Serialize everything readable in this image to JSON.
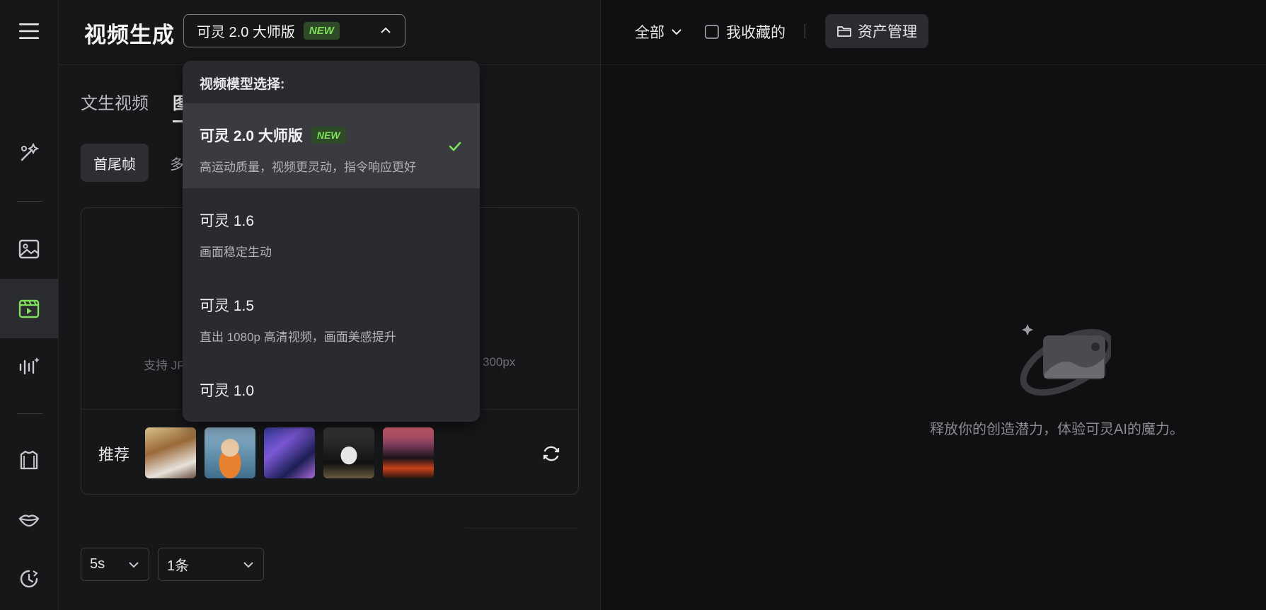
{
  "header": {
    "title": "视频生成",
    "model_label": "可灵 2.0 大师版",
    "new_badge": "NEW"
  },
  "tabs": [
    {
      "label": "文生视频"
    },
    {
      "label": "图"
    }
  ],
  "subtabs": [
    {
      "label": "首尾帧"
    },
    {
      "label": "多"
    }
  ],
  "upload": {
    "hint_left": "支持 JP",
    "hint_right": "300px"
  },
  "recommend": {
    "label": "推荐",
    "thumbnails": [
      "snowy-scene",
      "hamster-float",
      "city-neon",
      "white-figure",
      "lava-sunset"
    ]
  },
  "settings": {
    "duration": "5s",
    "count": "1条"
  },
  "dropdown": {
    "header": "视频模型选择:",
    "items": [
      {
        "name": "可灵 2.0 大师版",
        "badge": "NEW",
        "desc": "高运动质量，视频更灵动，指令响应更好",
        "selected": true
      },
      {
        "name": "可灵 1.6",
        "desc": "画面稳定生动"
      },
      {
        "name": "可灵 1.5",
        "desc": "直出 1080p 高清视频，画面美感提升"
      },
      {
        "name": "可灵 1.0",
        "desc": ""
      }
    ]
  },
  "right": {
    "filter_all": "全部",
    "favorites": "我收藏的",
    "asset_manage": "资产管理",
    "empty_text": "释放你的创造潜力，体验可灵AI的魔力。"
  },
  "colors": {
    "accent": "#7ee05b",
    "background": "#0f1012",
    "panel": "#161719",
    "dropdown": "#2a2b2f"
  }
}
